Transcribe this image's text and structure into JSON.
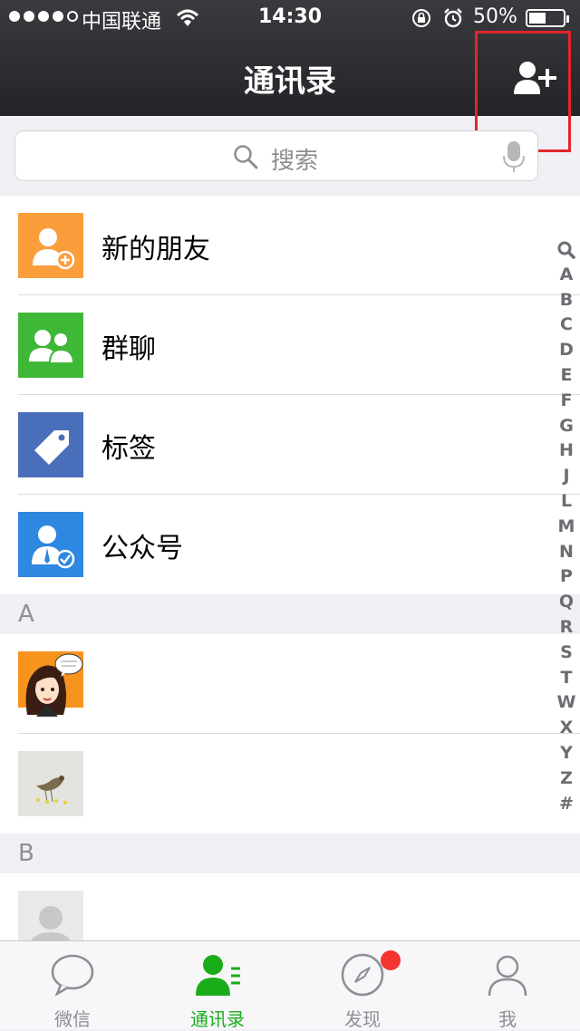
{
  "status_bar": {
    "carrier": "中国联通",
    "time": "14:30",
    "battery": "50%"
  },
  "header": {
    "title": "通讯录"
  },
  "search": {
    "placeholder": "搜索"
  },
  "functions": [
    {
      "label": "新的朋友",
      "icon": "new-friend-icon",
      "color": "#fa9d3b"
    },
    {
      "label": "群聊",
      "icon": "group-chat-icon",
      "color": "#3fb838"
    },
    {
      "label": "标签",
      "icon": "tag-icon",
      "color": "#4a6fba"
    },
    {
      "label": "公众号",
      "icon": "official-account-icon",
      "color": "#2e87e0"
    }
  ],
  "sections": [
    {
      "letter": "A"
    },
    {
      "letter": "B"
    }
  ],
  "index": [
    "A",
    "B",
    "C",
    "D",
    "E",
    "F",
    "G",
    "H",
    "J",
    "L",
    "M",
    "N",
    "P",
    "Q",
    "R",
    "S",
    "T",
    "W",
    "X",
    "Y",
    "Z",
    "#"
  ],
  "tabbar": [
    {
      "label": "微信",
      "icon": "chat-bubble-icon",
      "active": false
    },
    {
      "label": "通讯录",
      "icon": "contacts-icon",
      "active": true
    },
    {
      "label": "发现",
      "icon": "compass-icon",
      "active": false,
      "badge": true
    },
    {
      "label": "我",
      "icon": "profile-icon",
      "active": false
    }
  ],
  "colors": {
    "accent": "#1aad19",
    "highlight_box": "#e0272c",
    "badge": "#f43530"
  }
}
